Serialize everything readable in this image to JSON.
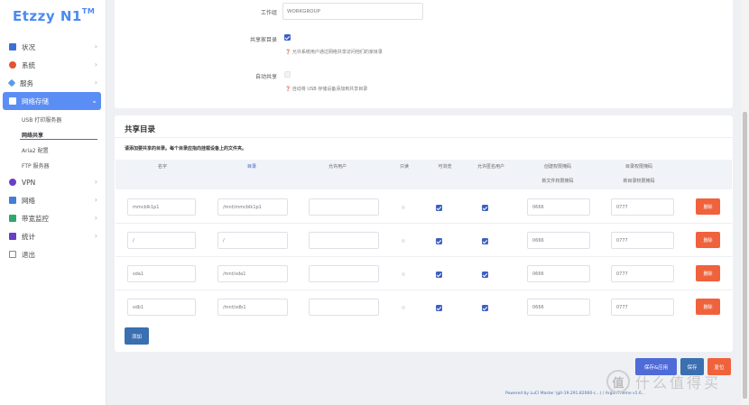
{
  "logo": {
    "text": "Etzzy N1",
    "tm": "TM"
  },
  "sidebar": {
    "items": [
      {
        "label": "状况",
        "icon": "dashboard-icon",
        "color": "#3d6fd6"
      },
      {
        "label": "系统",
        "icon": "gear-icon",
        "color": "#e2552f"
      },
      {
        "label": "服务",
        "icon": "puzzle-icon",
        "color": "#5a9ae8"
      },
      {
        "label": "网络存储",
        "icon": "storage-icon",
        "color": "#ffffff"
      },
      {
        "label": "VPN",
        "icon": "globe-icon",
        "color": "#6b3fc4"
      },
      {
        "label": "网络",
        "icon": "network-icon",
        "color": "#3f7fd6"
      },
      {
        "label": "带宽监控",
        "icon": "monitor-icon",
        "color": "#2fa86b"
      },
      {
        "label": "统计",
        "icon": "chart-icon",
        "color": "#6b3fc4"
      },
      {
        "label": "退出",
        "icon": "logout-icon",
        "color": "#888888"
      }
    ],
    "subitems": [
      "USB 打印服务器",
      "网络共享",
      "Aria2 配置",
      "FTP 服务器"
    ]
  },
  "settings": {
    "workgroup_label": "工作组",
    "workgroup_value": "WORKGROUP",
    "share_home_label": "共享家目录",
    "share_home_hint": "允许系统用户通过网络共享访问他们的家目录",
    "auto_share_label": "自动共享",
    "auto_share_hint": "自动将 USB 存储设备添加到共享目录"
  },
  "share_section": {
    "title": "共享目录",
    "description": "请添加要共享的目录。每个目录应指向挂载设备上的文件夹。",
    "headers": [
      "名字",
      "目录",
      "允许用户",
      "只读",
      "可浏览",
      "允许匿名用户",
      "创建权限掩码",
      "目录权限掩码"
    ],
    "subheaders": [
      "新文件权限掩码",
      "新目录权限掩码"
    ],
    "rows": [
      {
        "name": "mmcblk1p1",
        "path": "/mnt/mmcblk1p1",
        "users": "",
        "readonly": false,
        "browseable": true,
        "guest": true,
        "create_mask": "0666",
        "dir_mask": "0777",
        "delete": "删除"
      },
      {
        "name": "/",
        "path": "/",
        "users": "",
        "readonly": false,
        "browseable": true,
        "guest": true,
        "create_mask": "0666",
        "dir_mask": "0777",
        "delete": "删除"
      },
      {
        "name": "sda1",
        "path": "/mnt/sda1",
        "users": "",
        "readonly": false,
        "browseable": true,
        "guest": true,
        "create_mask": "0666",
        "dir_mask": "0777",
        "delete": "删除"
      },
      {
        "name": "sdb1",
        "path": "/mnt/sdb1",
        "users": "",
        "readonly": false,
        "browseable": true,
        "guest": true,
        "create_mask": "0666",
        "dir_mask": "0777",
        "delete": "删除"
      }
    ],
    "add_label": "添加"
  },
  "actions": {
    "save_apply": "保存&应用",
    "save": "保存",
    "reset": "复位"
  },
  "footer": "Powered by LuCI Master (git-19.291.82060-c...) / ArgonTheme v1.6...",
  "watermark": {
    "logo": "值",
    "text": "什么值得买"
  }
}
